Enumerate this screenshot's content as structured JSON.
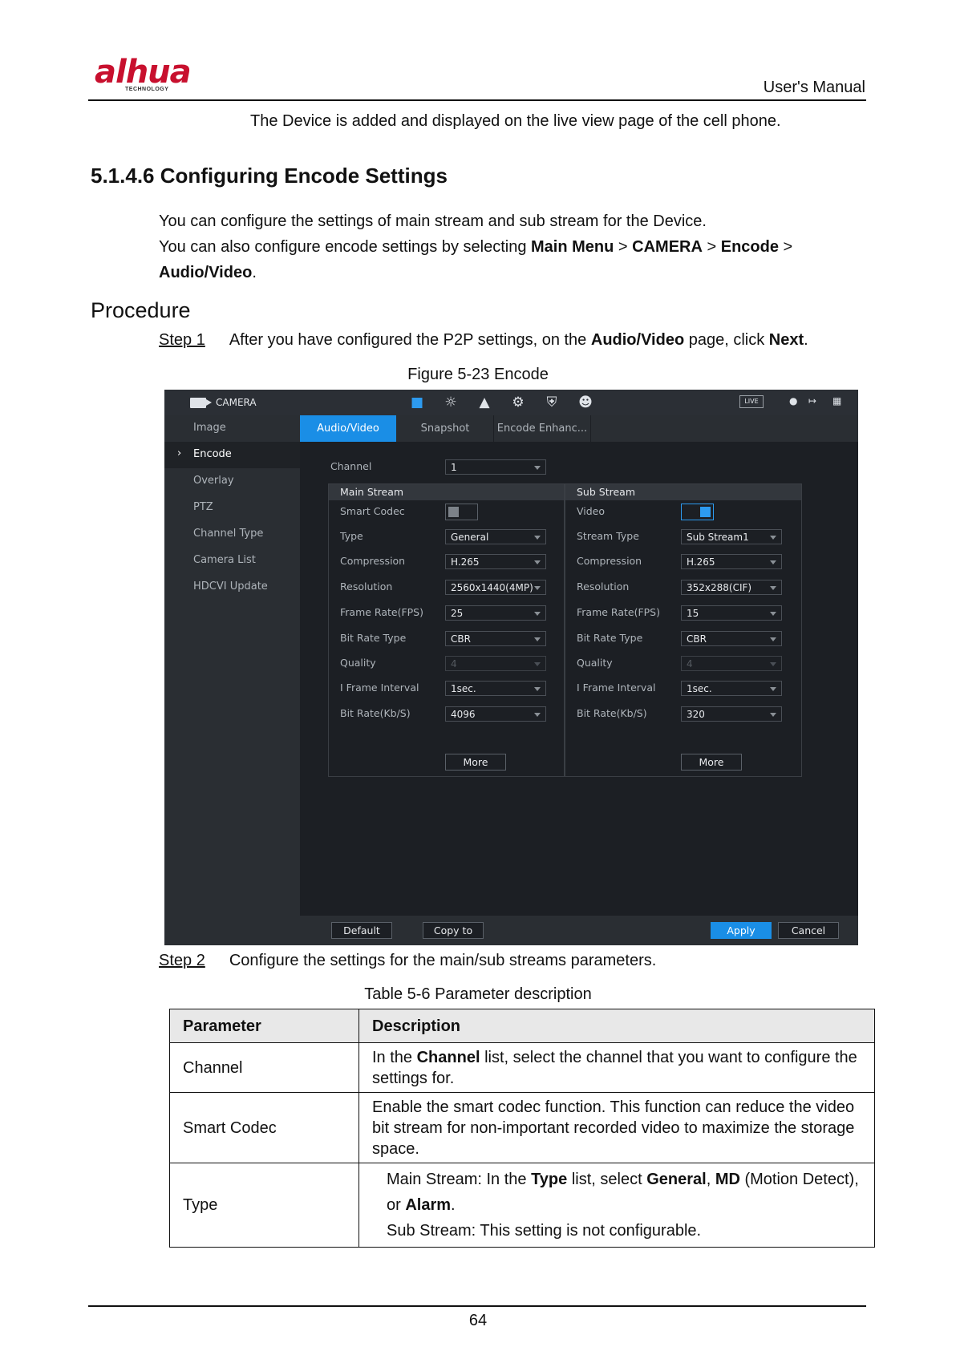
{
  "header": {
    "logo": "alhua",
    "logo_sub": "TECHNOLOGY",
    "title": "User's Manual"
  },
  "intro_line": "The Device is added and displayed on the live view page of the cell phone.",
  "section_title": "5.1.4.6 Configuring Encode Settings",
  "para1": "You can configure the settings of main stream and sub stream for the Device.",
  "para2": {
    "prefix": "You can also configure encode settings by selecting ",
    "b1": "Main Menu",
    "s1": " > ",
    "b2": "CAMERA",
    "s2": " > ",
    "b3": "Encode",
    "s3": " >",
    "b4": "Audio/Video",
    "end": "."
  },
  "procedure": "Procedure",
  "step1": {
    "label": "Step 1",
    "prefix": "After you have configured the P2P settings, on the ",
    "b1": "Audio/Video",
    "mid": " page, click ",
    "b2": "Next",
    "end": "."
  },
  "figure_caption": "Figure 5-23 Encode",
  "ui": {
    "topbar": {
      "title": "CAMERA",
      "live": "LIVE"
    },
    "sidebar": [
      "Image",
      "Encode",
      "Overlay",
      "PTZ",
      "Channel Type",
      "Camera List",
      "HDCVI Update"
    ],
    "tabs": [
      "Audio/Video",
      "Snapshot",
      "Encode Enhanc..."
    ],
    "channel": {
      "label": "Channel",
      "value": "1"
    },
    "main": {
      "title": "Main Stream",
      "rows": [
        {
          "label": "Smart Codec",
          "value": ""
        },
        {
          "label": "Type",
          "value": "General"
        },
        {
          "label": "Compression",
          "value": "H.265"
        },
        {
          "label": "Resolution",
          "value": "2560x1440(4MP)"
        },
        {
          "label": "Frame Rate(FPS)",
          "value": "25"
        },
        {
          "label": "Bit Rate Type",
          "value": "CBR"
        },
        {
          "label": "Quality",
          "value": "4"
        },
        {
          "label": "I Frame Interval",
          "value": "1sec."
        },
        {
          "label": "Bit Rate(Kb/S)",
          "value": "4096"
        }
      ],
      "more": "More"
    },
    "sub": {
      "title": "Sub Stream",
      "rows": [
        {
          "label": "Video",
          "value": ""
        },
        {
          "label": "Stream Type",
          "value": "Sub Stream1"
        },
        {
          "label": "Compression",
          "value": "H.265"
        },
        {
          "label": "Resolution",
          "value": "352x288(CIF)"
        },
        {
          "label": "Frame Rate(FPS)",
          "value": "15"
        },
        {
          "label": "Bit Rate Type",
          "value": "CBR"
        },
        {
          "label": "Quality",
          "value": "4"
        },
        {
          "label": "I Frame Interval",
          "value": "1sec."
        },
        {
          "label": "Bit Rate(Kb/S)",
          "value": "320"
        }
      ],
      "more": "More"
    },
    "buttons": {
      "default": "Default",
      "copy": "Copy to",
      "apply": "Apply",
      "cancel": "Cancel"
    }
  },
  "step2": {
    "label": "Step 2",
    "text": "Configure the settings for the main/sub streams parameters."
  },
  "table_caption": "Table 5-6 Parameter description",
  "table": {
    "headers": [
      "Parameter",
      "Description"
    ],
    "r1": {
      "param": "Channel",
      "pre": "In the ",
      "b": "Channel",
      "post": " list, select the channel that you want to configure the settings for."
    },
    "r2": {
      "param": "Smart Codec",
      "desc": "Enable the smart codec function. This function can reduce the video bit stream for non-important recorded video to maximize the storage space."
    },
    "r3": {
      "param": "Type",
      "l1_pre": "Main Stream: In the ",
      "l1_b1": "Type",
      "l1_mid": " list, select ",
      "l1_b2": "General",
      "l1_c": ", ",
      "l1_b3": "MD",
      "l1_post": " (Motion Detect),",
      "l2_pre": "or ",
      "l2_b": "Alarm",
      "l2_end": ".",
      "l3": "Sub Stream: This setting is not configurable."
    }
  },
  "page_number": "64"
}
